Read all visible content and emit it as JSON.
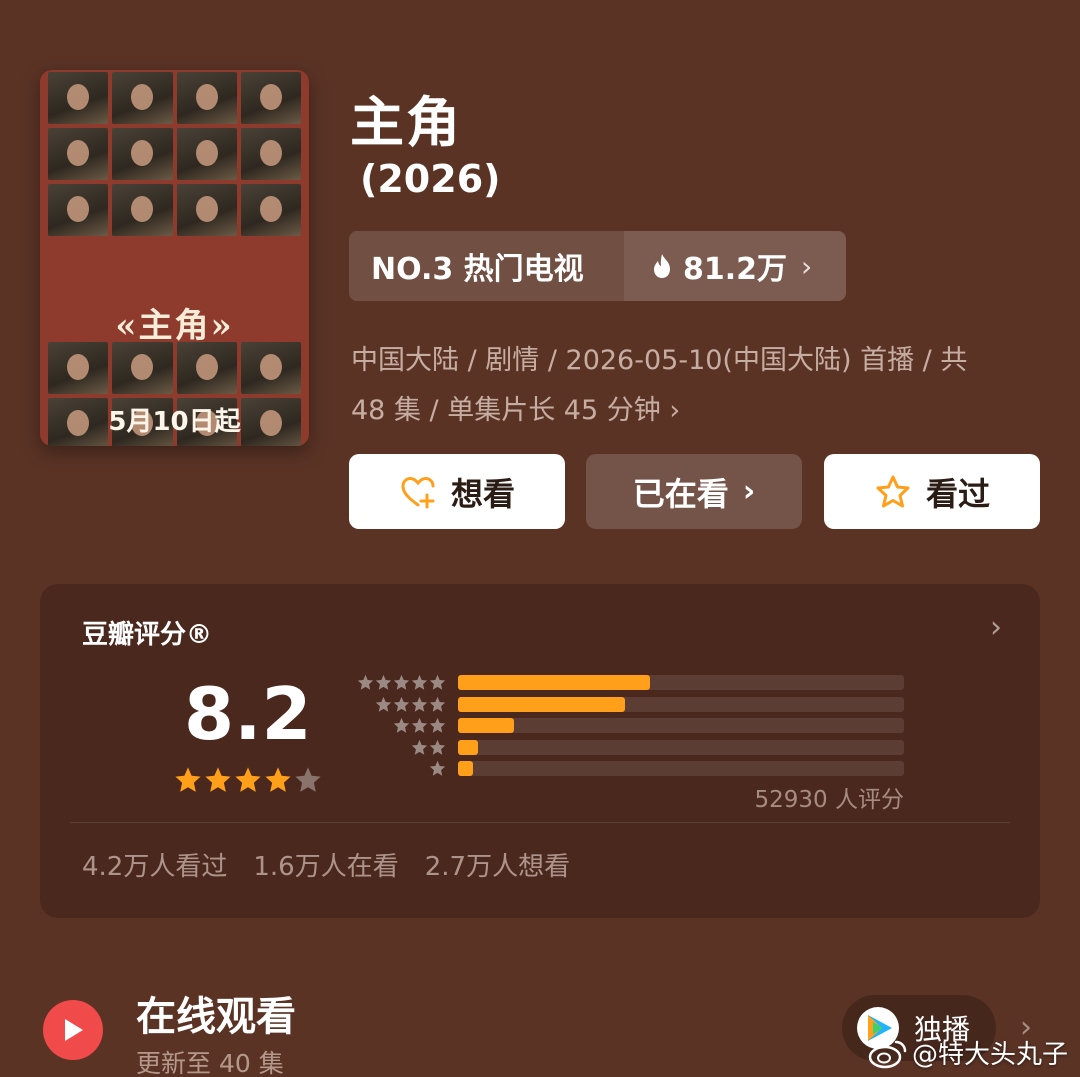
{
  "poster": {
    "title": "«主角»",
    "date": "5月10日起"
  },
  "show": {
    "title": "主角",
    "year": "(2026)"
  },
  "rank": {
    "label": "NO.3 热门电视",
    "hot_value": "81.2万"
  },
  "meta": {
    "line1": "中国大陆 / 剧情 / 2026-05-10(中国大陆) 首播 / 共",
    "line2": "48 集 / 单集片长 45 分钟"
  },
  "actions": {
    "want_label": "想看",
    "watching_label": "已在看",
    "watched_label": "看过"
  },
  "rating": {
    "title": "豆瓣评分®",
    "score": "8.2",
    "stars_filled": 4,
    "stars_total": 5,
    "count_label": "52930 人评分",
    "distribution": [
      {
        "stars": 5,
        "fraction": 0.43
      },
      {
        "stars": 4,
        "fraction": 0.375
      },
      {
        "stars": 3,
        "fraction": 0.125
      },
      {
        "stars": 2,
        "fraction": 0.045
      },
      {
        "stars": 1,
        "fraction": 0.033
      }
    ],
    "stats": [
      "4.2万人看过",
      "1.6万人在看",
      "2.7万人想看"
    ]
  },
  "online": {
    "title": "在线观看",
    "subtitle": "更新至 40 集",
    "exclusive_label": "独播"
  },
  "watermark": {
    "text": "@特大头丸子"
  },
  "colors": {
    "background": "#5a3325",
    "accent_orange": "#ff9f1a",
    "play_red": "#f04a4a"
  }
}
